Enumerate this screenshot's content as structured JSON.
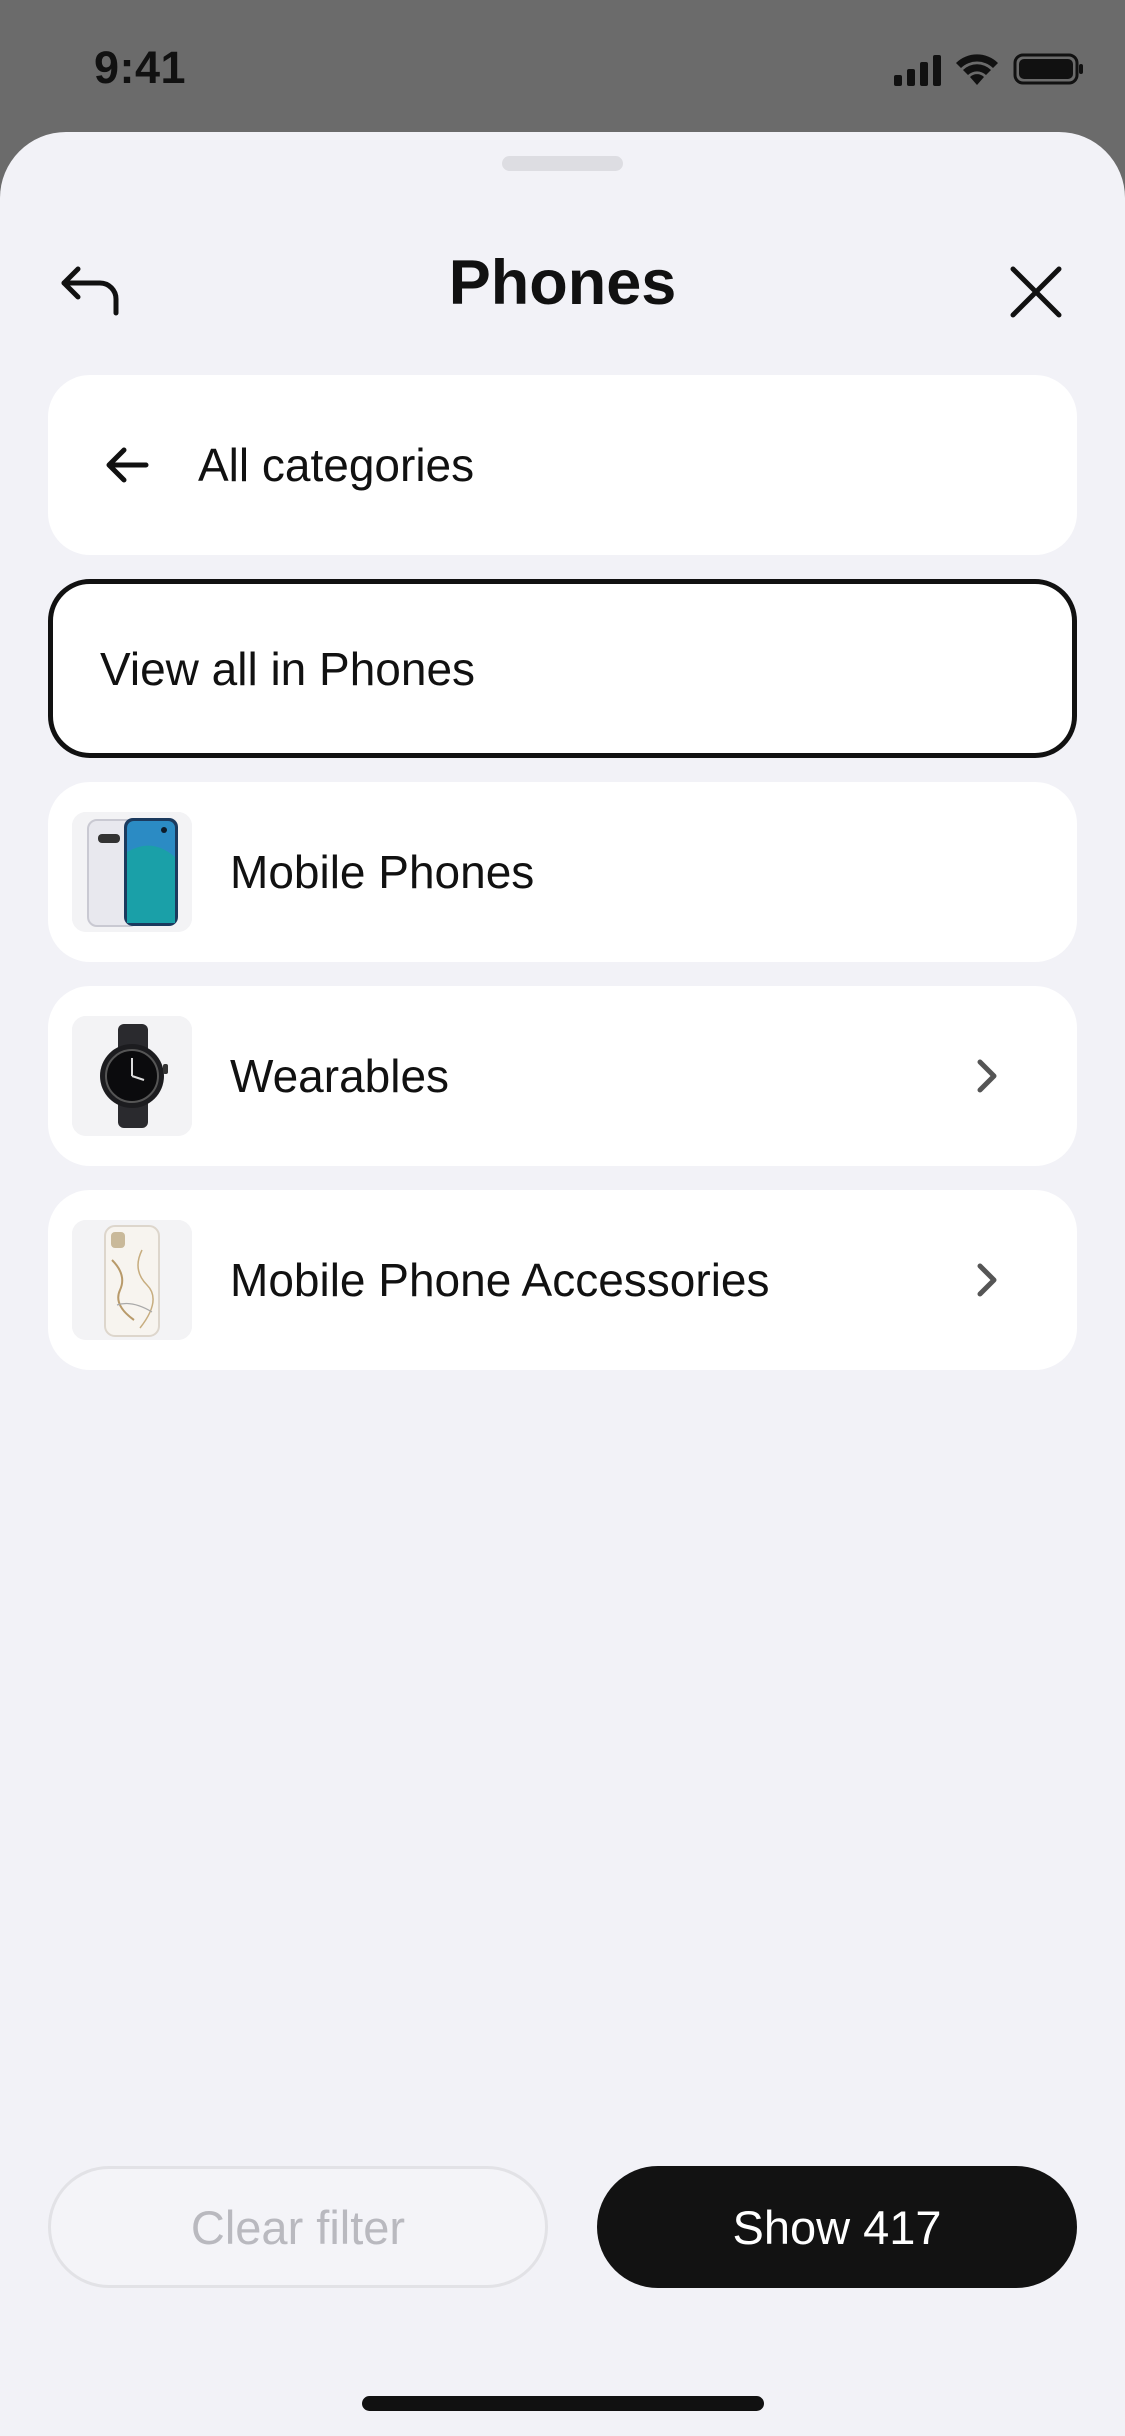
{
  "status_bar": {
    "time": "9:41",
    "icons": [
      "signal-icon",
      "wifi-icon",
      "battery-icon"
    ]
  },
  "header": {
    "title": "Phones",
    "back_icon": "undo-arrow-icon",
    "close_icon": "close-icon"
  },
  "list": {
    "all_categories": {
      "label": "All categories",
      "icon": "arrow-left-icon"
    },
    "view_all": {
      "label": "View all in Phones",
      "selected": true
    },
    "items": [
      {
        "label": "Mobile Phones",
        "thumbnail": "smartphone",
        "has_children": false
      },
      {
        "label": "Wearables",
        "thumbnail": "smartwatch",
        "has_children": true
      },
      {
        "label": "Mobile Phone Accessories",
        "thumbnail": "phone-case",
        "has_children": true
      }
    ]
  },
  "footer": {
    "clear_label": "Clear filter",
    "show_label": "Show 417"
  },
  "colors": {
    "backdrop": "#6b6b6b",
    "sheet": "#f2f2f7",
    "primary_button": "#121212",
    "disabled_text": "#b9b9bf"
  }
}
